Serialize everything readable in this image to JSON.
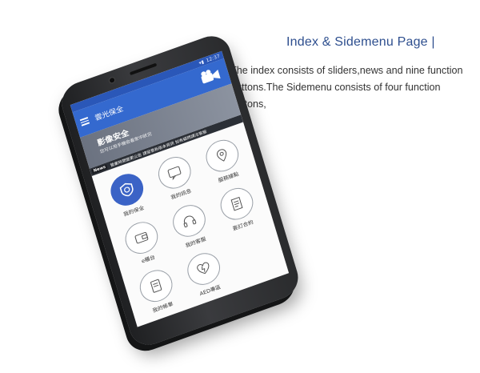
{
  "headline": "Index & Sidemenu Page |",
  "description": "The index consists of sliders,news and nine function buttons.The Sidemenu consists of four function buttons,",
  "phone": {
    "status_time": "12:37",
    "app_title": "雲光保全",
    "slider": {
      "title": "影像安全",
      "subtitle": "您可以用手機收看家中狀況"
    },
    "news": {
      "tag": "News",
      "text": "營業時間變更公告 請留意新版本資訊 如有疑問請洽客服"
    },
    "functions": [
      {
        "label": "我的保全",
        "icon": "shield-icon",
        "active": true
      },
      {
        "label": "我的訊息",
        "icon": "message-icon",
        "active": false
      },
      {
        "label": "服務據點",
        "icon": "location-pin-icon",
        "active": false
      },
      {
        "label": "e櫃台",
        "icon": "wallet-icon",
        "active": false
      },
      {
        "label": "我的客服",
        "icon": "headset-icon",
        "active": false
      },
      {
        "label": "簽訂合約",
        "icon": "contract-icon",
        "active": false
      },
      {
        "label": "我的帳單",
        "icon": "bill-icon",
        "active": false
      },
      {
        "label": "AED專區",
        "icon": "aed-icon",
        "active": false
      }
    ]
  },
  "colors": {
    "headline": "#2d4e8e",
    "appbar": "#3469cf",
    "active_button": "#3b63c6"
  }
}
